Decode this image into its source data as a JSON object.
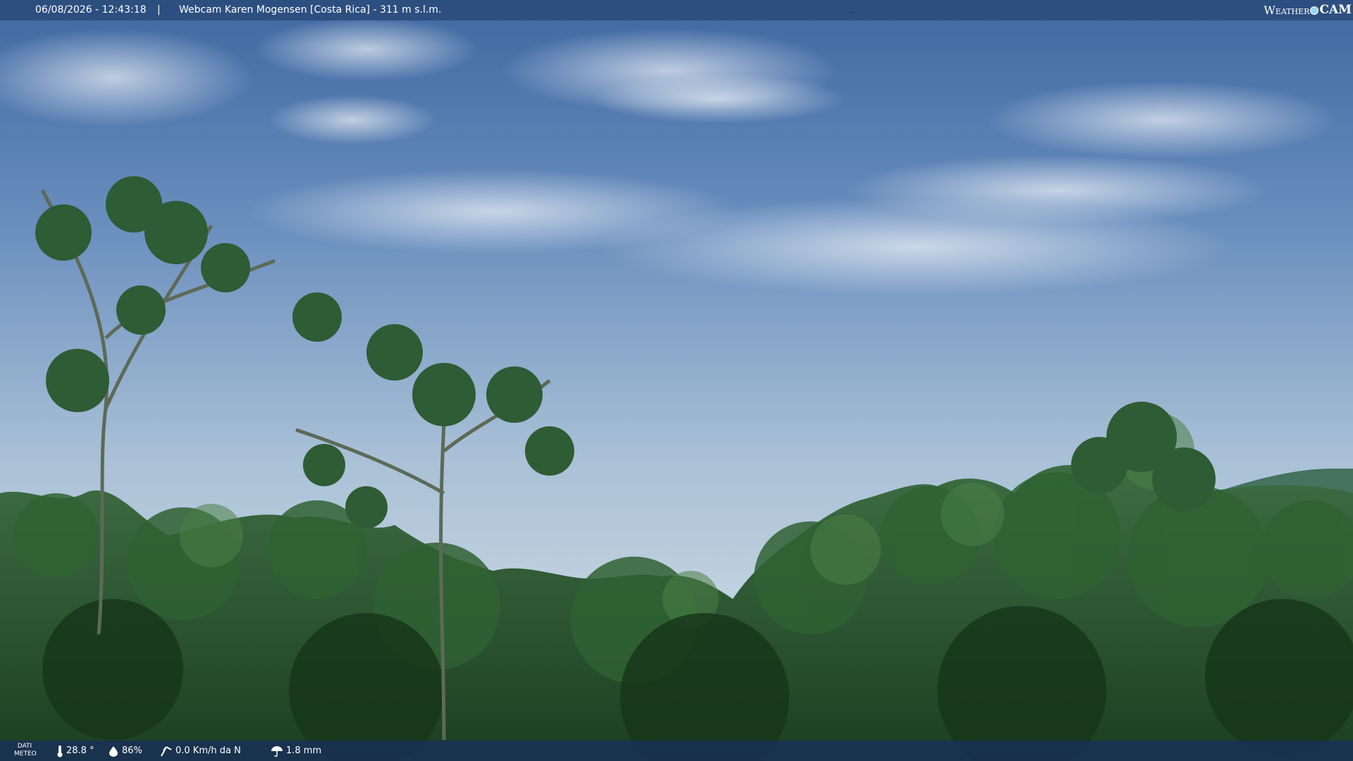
{
  "overlay": {
    "datetime": "06/08/2026 - 12:43:18",
    "separator": "|",
    "camera_title": "Webcam Karen Mogensen [Costa Rica]  - 311 m s.l.m.",
    "brand_left": "Weather",
    "brand_right": "CAM"
  },
  "weather": {
    "label_line1": "DATI",
    "label_line2": "METEO",
    "temperature": "28.8 °",
    "humidity": "86%",
    "wind": "0.0 Km/h da N",
    "rain": "1.8 mm"
  },
  "icons": {
    "temperature": "thermometer-icon",
    "humidity": "humidity-drop-icon",
    "wind": "wind-icon",
    "rain": "rain-umbrella-icon"
  },
  "colors": {
    "top_bar": "#284876",
    "bottom_bar": "#183058",
    "sky": "#5f86b8",
    "forest": "#2a5a2c"
  }
}
